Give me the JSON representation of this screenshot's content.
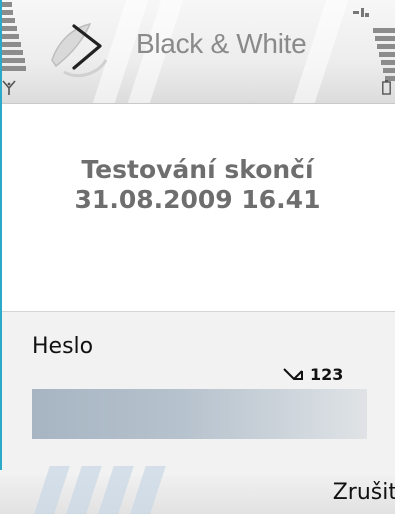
{
  "header": {
    "app_title": "Black & White"
  },
  "message": {
    "line1": "Testování skončí",
    "line2": "31.08.2009 16.41"
  },
  "query": {
    "label": "Heslo",
    "input_mode": "123",
    "value": ""
  },
  "softkeys": {
    "right": "Zrušit"
  },
  "colors": {
    "accent_edge": "#2aa9c9",
    "text_primary": "#111111",
    "text_secondary": "#6e6e6e"
  }
}
